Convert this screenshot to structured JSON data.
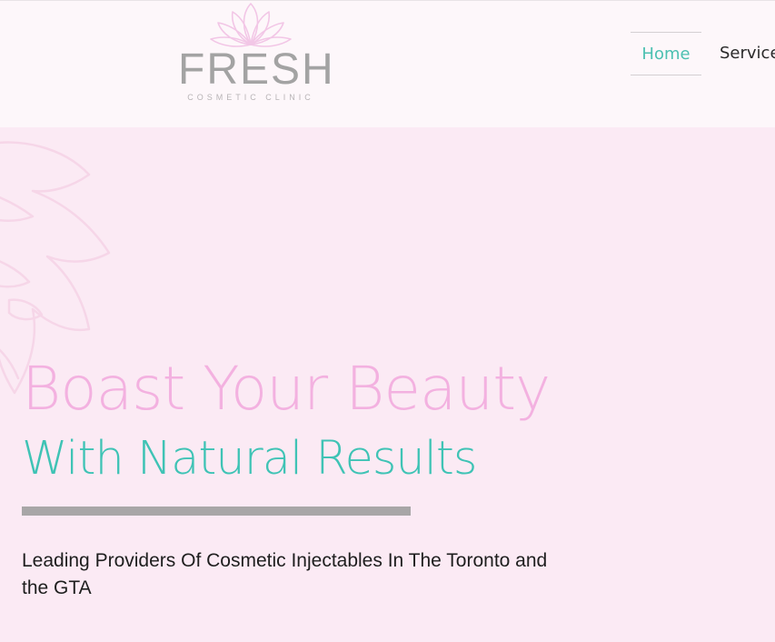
{
  "brand": {
    "name": "FRESH",
    "tagline": "COSMETIC CLINIC",
    "logo_icon": "lotus-icon",
    "logo_color": "#f2c6e6"
  },
  "nav": {
    "items": [
      {
        "label": "Home",
        "active": true
      },
      {
        "label": "Service"
      }
    ],
    "active_color": "#4cc0b1"
  },
  "hero": {
    "headline": "Boast Your Beauty",
    "subheadline": "With Natural Results",
    "description": "Leading Providers Of Cosmetic Injectables In The Toronto and the GTA",
    "headline_color": "#f3b1e0",
    "subheadline_color": "#3fc3b5",
    "background_color": "#fbeaf4",
    "decoration_icon": "monstera-leaf-icon"
  }
}
